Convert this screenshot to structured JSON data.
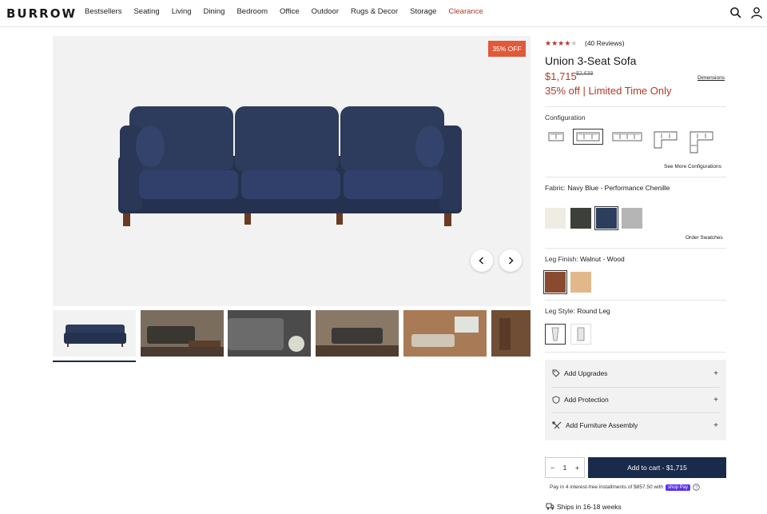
{
  "nav": {
    "logo": "BURROW",
    "items": [
      "Bestsellers",
      "Seating",
      "Living",
      "Dining",
      "Bedroom",
      "Office",
      "Outdoor",
      "Rugs & Decor",
      "Storage",
      "Clearance"
    ],
    "icons": [
      "search-icon",
      "account-icon"
    ]
  },
  "gallery": {
    "badge": "35% OFF",
    "thumbnail_count": 6,
    "selected_index": 0
  },
  "product": {
    "rating": 3.5,
    "rating_max": 5,
    "reviews": "(40 Reviews)",
    "title": "Union 3-Seat Sofa",
    "price": "$1,715",
    "old_price": "$2,639",
    "dimensions_link": "Dimensions",
    "promo": "35% off | Limited Time Only"
  },
  "configuration": {
    "label": "Configuration",
    "selected_index": 1,
    "options_count": 5,
    "more_link": "See More Configurations"
  },
  "fabric": {
    "label": "Fabric:",
    "value": "Navy Blue - Performance Chenille",
    "swatches": [
      "#efece3",
      "#3d3f3a",
      "#2d3d5c",
      "#b5b5b5"
    ],
    "selected_index": 2,
    "order_link": "Order Swatches"
  },
  "leg_finish": {
    "label": "Leg Finish:",
    "value": "Walnut - Wood",
    "swatches": [
      "#8a4a30",
      "#e2b88a"
    ],
    "selected_index": 0
  },
  "leg_style": {
    "label": "Leg Style:",
    "value": "Round Leg",
    "selected_index": 0
  },
  "addons": [
    {
      "label": "Add Upgrades",
      "icon": "tag-icon"
    },
    {
      "label": "Add Protection",
      "icon": "shield-icon"
    },
    {
      "label": "Add Furniture Assembly",
      "icon": "tools-icon"
    }
  ],
  "purchase": {
    "quantity": "1",
    "minus": "−",
    "plus": "+",
    "cart_label": "Add to cart - $1,715",
    "installments": "Pay in 4 interest-free installments of $857.50 with",
    "shop_pay": "shop Pay",
    "ships": "Ships in 16-18 weeks"
  },
  "colors": {
    "accent": "#b23a2a",
    "primary": "#1a2a4a",
    "badge": "#e05a3a"
  }
}
